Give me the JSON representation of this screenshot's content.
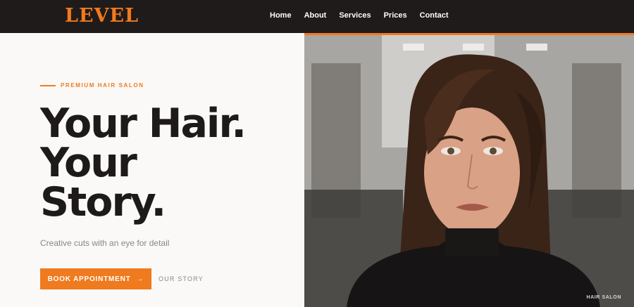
{
  "brand": {
    "logo": "LEVEL",
    "accent_color": "#f07a1e",
    "dark_color": "#1f1b1a"
  },
  "nav": {
    "items": [
      "Home",
      "About",
      "Services",
      "Prices",
      "Contact"
    ]
  },
  "hero": {
    "eyebrow": "PREMIUM HAIR SALON",
    "headline_lines": [
      "Your Hair.",
      "Your",
      "Story."
    ],
    "subtitle": "Creative cuts with an eye for detail",
    "cta_primary": "BOOK APPOINTMENT",
    "cta_primary_icon": "arrow-right-icon",
    "cta_secondary": "OUR STORY"
  },
  "photo": {
    "caption": "HAIR SALON"
  }
}
